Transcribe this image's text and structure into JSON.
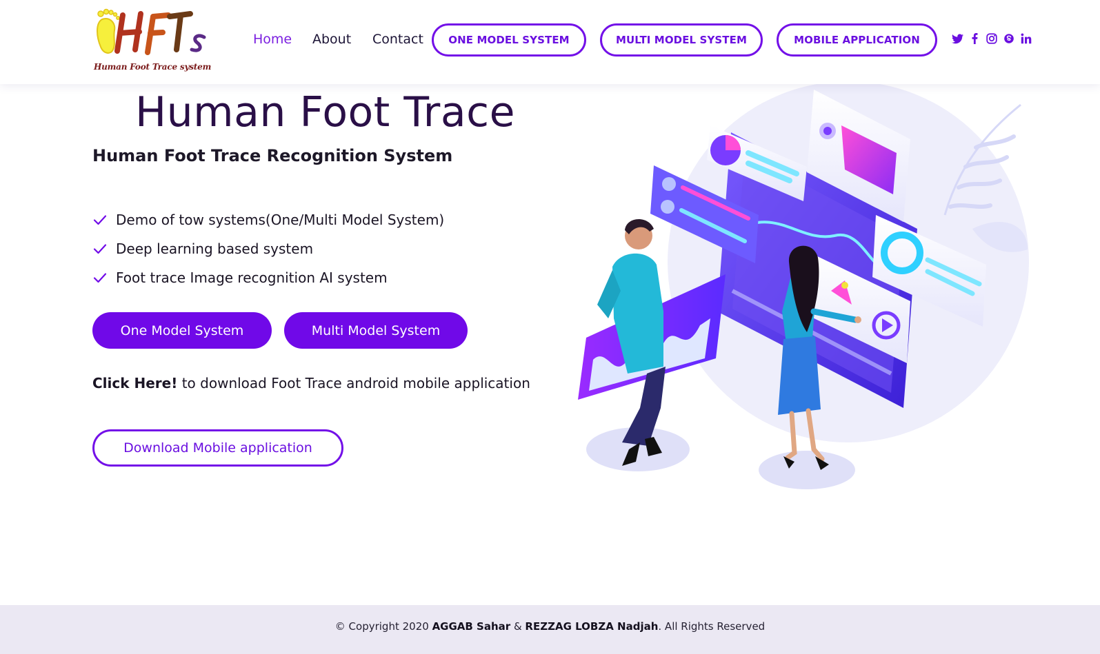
{
  "brand": {
    "logo_letters": "HFTs",
    "logo_caption": "Human Foot Trace system",
    "colors": {
      "accent": "#7009e8",
      "title": "#2a0f47",
      "footer_bg": "#ebe8f3"
    }
  },
  "nav": {
    "links": [
      {
        "label": "Home",
        "active": true
      },
      {
        "label": "About",
        "active": false
      },
      {
        "label": "Contact",
        "active": false
      }
    ],
    "buttons": [
      "ONE MODEL SYSTEM",
      "MULTI MODEL SYSTEM",
      "MOBILE APPLICATION"
    ],
    "social_icons": [
      "twitter-icon",
      "facebook-icon",
      "instagram-icon",
      "skype-icon",
      "linkedin-icon"
    ]
  },
  "hero": {
    "title": "Human Foot Trace",
    "subtitle": "Human Foot Trace Recognition System",
    "features": [
      "Demo of tow systems(One/Multi Model System)",
      "Deep learning based system",
      "Foot trace Image recognition AI system"
    ],
    "primary_buttons": [
      "One Model System",
      "Multi Model System"
    ],
    "click_here": "Click Here!",
    "click_text": " to download Foot Trace android mobile application",
    "download_button": "Download Mobile application"
  },
  "footer": {
    "prefix": "© Copyright 2020 ",
    "author1": "AGGAB Sahar",
    "amp": " & ",
    "author2": "REZZAG LOBZA Nadjah",
    "suffix": ". All Rights Reserved"
  }
}
